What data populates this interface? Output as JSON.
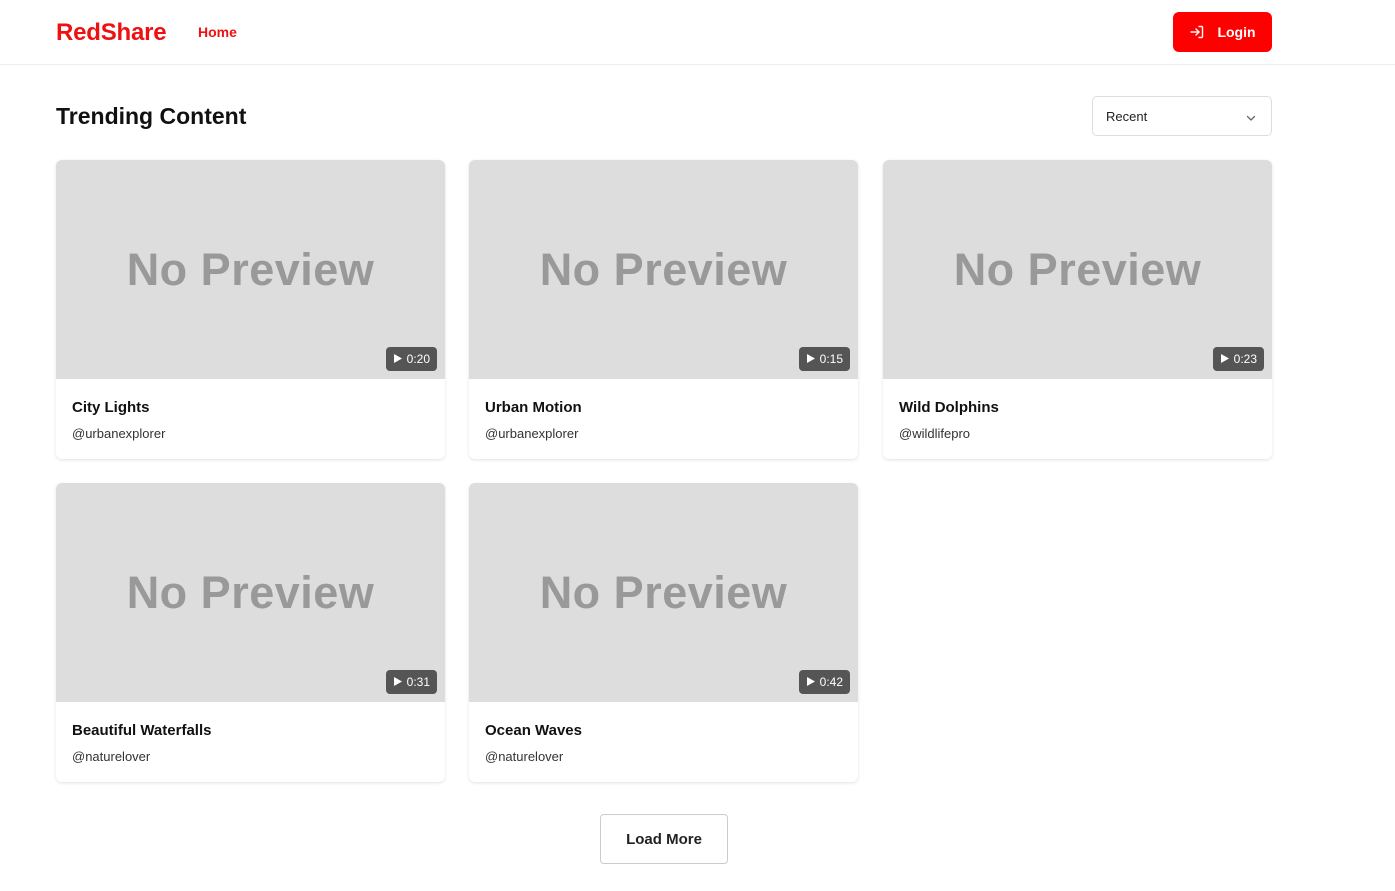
{
  "header": {
    "brand": "RedShare",
    "nav_home": "Home",
    "login_label": "Login",
    "accent_color": "#ff0000"
  },
  "main": {
    "section_title": "Trending Content",
    "sort": {
      "selected": "Recent"
    },
    "preview_placeholder": "No Preview",
    "cards": [
      {
        "title": "City Lights",
        "author": "@urbanexplorer",
        "duration": "0:20"
      },
      {
        "title": "Urban Motion",
        "author": "@urbanexplorer",
        "duration": "0:15"
      },
      {
        "title": "Wild Dolphins",
        "author": "@wildlifepro",
        "duration": "0:23"
      },
      {
        "title": "Beautiful Waterfalls",
        "author": "@naturelover",
        "duration": "0:31"
      },
      {
        "title": "Ocean Waves",
        "author": "@naturelover",
        "duration": "0:42"
      }
    ],
    "load_more_label": "Load More"
  },
  "icons": {
    "login": "login-arrow-icon",
    "sort_chevron": "chevron-down-icon",
    "duration": "play-icon"
  }
}
